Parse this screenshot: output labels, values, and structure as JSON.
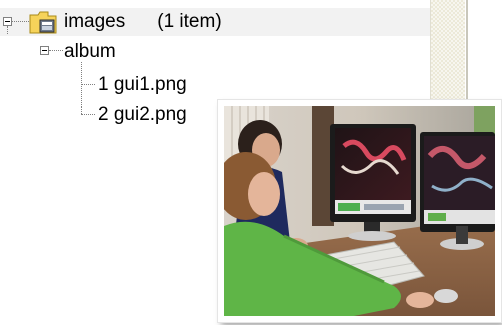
{
  "tree": {
    "root": {
      "label": "images",
      "count": "(1 item)",
      "icon": "database-folder-icon",
      "expander": "minus"
    },
    "child": {
      "label": "album",
      "expander": "minus"
    },
    "files": [
      {
        "label": "1 gui1.png"
      },
      {
        "label": "2 gui2.png"
      }
    ]
  },
  "preview": {
    "icon": "photo-thumbnail-image",
    "subject": "two people at desk with dual monitors"
  },
  "colors": {
    "selection_bg": "#f2f2f2",
    "tree_lines": "#808080",
    "folder_yellow": "#f6d35a"
  }
}
